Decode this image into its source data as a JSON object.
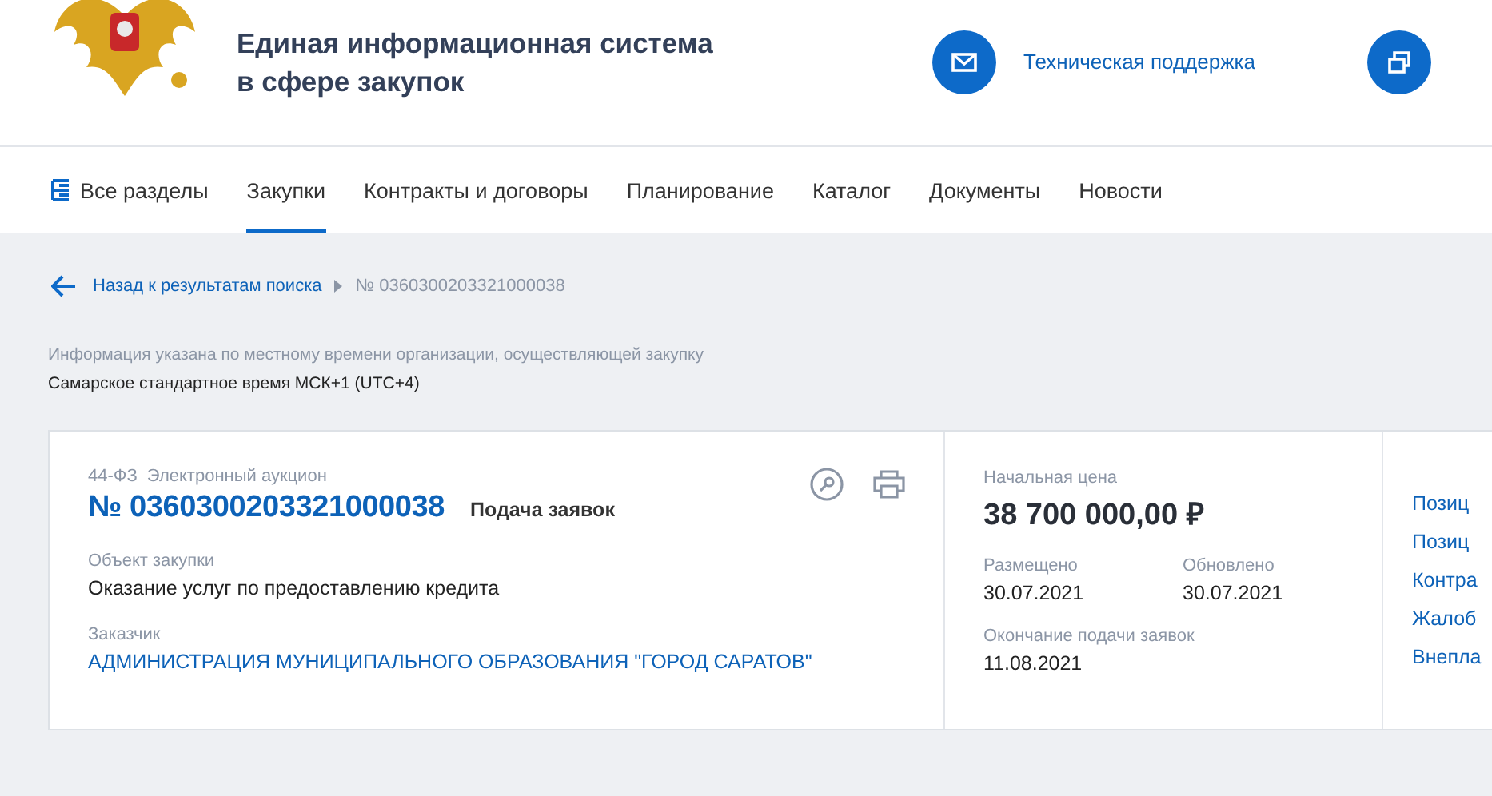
{
  "header": {
    "title_lines": [
      "Единая информационная система",
      "в сфере закупок"
    ],
    "support_link": "Техническая поддержка"
  },
  "nav": {
    "items": [
      {
        "label": "Все разделы",
        "kind": "menu",
        "selected": false
      },
      {
        "label": "Закупки",
        "kind": "link",
        "selected": true
      },
      {
        "label": "Контракты и договоры",
        "kind": "link",
        "selected": false
      },
      {
        "label": "Планирование",
        "kind": "link",
        "selected": false
      },
      {
        "label": "Каталог",
        "kind": "link",
        "selected": false
      },
      {
        "label": "Документы",
        "kind": "link",
        "selected": false
      },
      {
        "label": "Новости",
        "kind": "link",
        "selected": false
      }
    ]
  },
  "breadcrumb": {
    "back": "Назад к результатам поиска",
    "current": "№ 0360300203321000038"
  },
  "timezone": {
    "note": "Информация указана по местному времени организации, осуществляющей закупку",
    "value": "Самарское стандартное время МСК+1 (UTC+4)"
  },
  "card": {
    "law": "44-ФЗ",
    "method": "Электронный аукцион",
    "number": "№ 0360300203321000038",
    "status": "Подача заявок",
    "fields": [
      {
        "label": "Объект закупки",
        "value": "Оказание услуг по предоставлению кредита",
        "kind": "text"
      },
      {
        "label": "Заказчик",
        "value": "АДМИНИСТРАЦИЯ МУНИЦИПАЛЬНОГО ОБРАЗОВАНИЯ \"ГОРОД САРАТОВ\"",
        "kind": "link"
      }
    ],
    "price_label": "Начальная цена",
    "price": "38 700 000,00 ₽",
    "dates": [
      {
        "label": "Размещено",
        "value": "30.07.2021"
      },
      {
        "label": "Обновлено",
        "value": "30.07.2021"
      }
    ],
    "deadline_label": "Окончание подачи заявок",
    "deadline": "11.08.2021",
    "side_links": [
      "Позиц",
      "Позиц",
      "Контра",
      "Жалоб",
      "Внепла"
    ]
  }
}
